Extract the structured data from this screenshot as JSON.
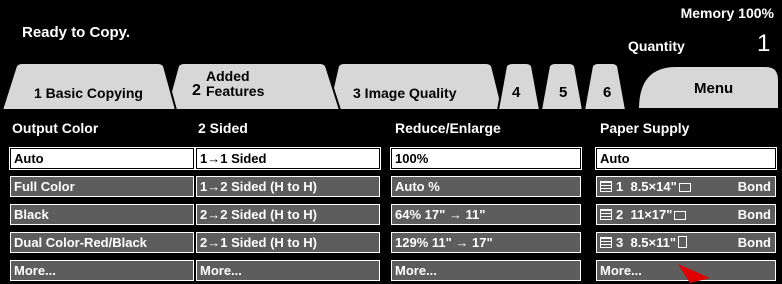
{
  "header": {
    "status": "Ready to Copy.",
    "memory": "Memory 100%",
    "quantity_label": "Quantity",
    "quantity_value": "1"
  },
  "tabs": {
    "basic": "1 Basic Copying",
    "added_num": "2",
    "added_line1": "Added",
    "added_line2": "Features",
    "image_quality": "3 Image Quality",
    "t4": "4",
    "t5": "5",
    "t6": "6",
    "menu": "Menu"
  },
  "output_color": {
    "title": "Output Color",
    "options": [
      "Auto",
      "Full Color",
      "Black",
      "Dual Color-Red/Black",
      "More..."
    ],
    "selected": "Auto"
  },
  "two_sided": {
    "title": "2 Sided",
    "options": [
      "1→1 Sided",
      "1→2 Sided (H to H)",
      "2→2 Sided (H to H)",
      "2→1 Sided (H to H)",
      "More..."
    ],
    "selected": "1→1 Sided"
  },
  "reduce_enlarge": {
    "title": "Reduce/Enlarge",
    "options": [
      "100%",
      "Auto %",
      "64%  17\" → 11\"",
      "129% 11\" → 17\"",
      "More..."
    ],
    "selected": "100%"
  },
  "paper_supply": {
    "title": "Paper Supply",
    "auto": "Auto",
    "trays": [
      {
        "num": "1",
        "size": "8.5×14\"",
        "type": "Bond",
        "orientation": "landscape"
      },
      {
        "num": "2",
        "size": "11×17\"",
        "type": "Bond",
        "orientation": "landscape"
      },
      {
        "num": "3",
        "size": "8.5×11\"",
        "type": "Bond",
        "orientation": "portrait"
      }
    ],
    "more": "More...",
    "selected": "Auto"
  },
  "colors": {
    "panel_bg": "#000000",
    "button_bg": "#5d5d5d",
    "selected_bg": "#ffffff",
    "tab_bg": "#d7d7d7",
    "pointer": "#e00000"
  }
}
